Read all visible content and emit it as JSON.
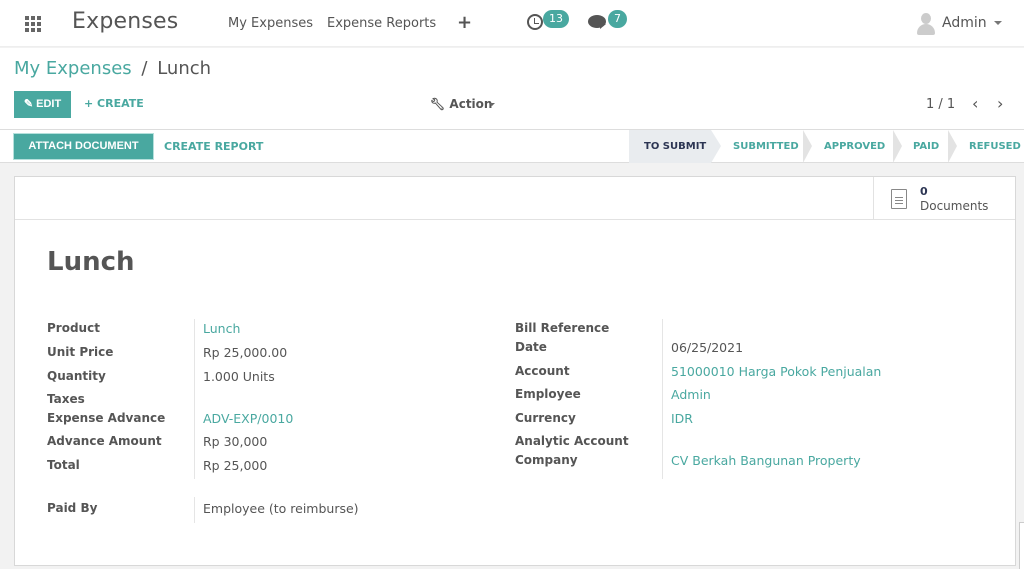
{
  "topbar": {
    "app_title": "Expenses",
    "menu": [
      "My Expenses",
      "Expense Reports"
    ],
    "activity_count": "13",
    "message_count": "7",
    "user_name": "Admin"
  },
  "control_panel": {
    "breadcrumb": {
      "parent": "My Expenses",
      "separator": "/",
      "current": "Lunch"
    },
    "edit_label": "EDIT",
    "create_label": "+ CREATE",
    "action_label": "Action",
    "pager": "1 / 1",
    "pager_prev": "‹",
    "pager_next": "›"
  },
  "statusbar": {
    "attach_label": "ATTACH DOCUMENT",
    "report_label": "CREATE REPORT",
    "stages": [
      "TO SUBMIT",
      "SUBMITTED",
      "APPROVED",
      "PAID",
      "REFUSED"
    ],
    "active_stage": "TO SUBMIT"
  },
  "sheet": {
    "documents_count": "0",
    "documents_label": "Documents",
    "title": "Lunch",
    "left_fields": [
      {
        "label": "Product",
        "value": "Lunch",
        "link": true
      },
      {
        "label": "Unit Price",
        "value": "Rp 25,000.00",
        "link": false
      },
      {
        "label": "Quantity",
        "value": "1.000  Units",
        "link": false
      },
      {
        "label": "Taxes",
        "value": "",
        "link": false
      },
      {
        "label": "Expense Advance",
        "value": "ADV-EXP/0010",
        "link": true
      },
      {
        "label": "Advance Amount",
        "value": "Rp 30,000",
        "link": false
      },
      {
        "label": "Total",
        "value": "Rp 25,000",
        "link": false
      }
    ],
    "paid_by": {
      "label": "Paid By",
      "value": "Employee (to reimburse)"
    },
    "right_fields": [
      {
        "label": "Bill Reference",
        "value": "",
        "link": false
      },
      {
        "label": "Date",
        "value": "06/25/2021",
        "link": false
      },
      {
        "label": "Account",
        "value": "51000010 Harga Pokok Penjualan",
        "link": true
      },
      {
        "label": "Employee",
        "value": "Admin",
        "link": true
      },
      {
        "label": "Currency",
        "value": "IDR",
        "link": true
      },
      {
        "label": "Analytic Account",
        "value": "",
        "link": false
      },
      {
        "label": "Company",
        "value": "CV Berkah Bangunan Property",
        "link": true
      }
    ]
  },
  "colors": {
    "accent": "#49a8a0",
    "active_stage_text": "#2c3553"
  }
}
